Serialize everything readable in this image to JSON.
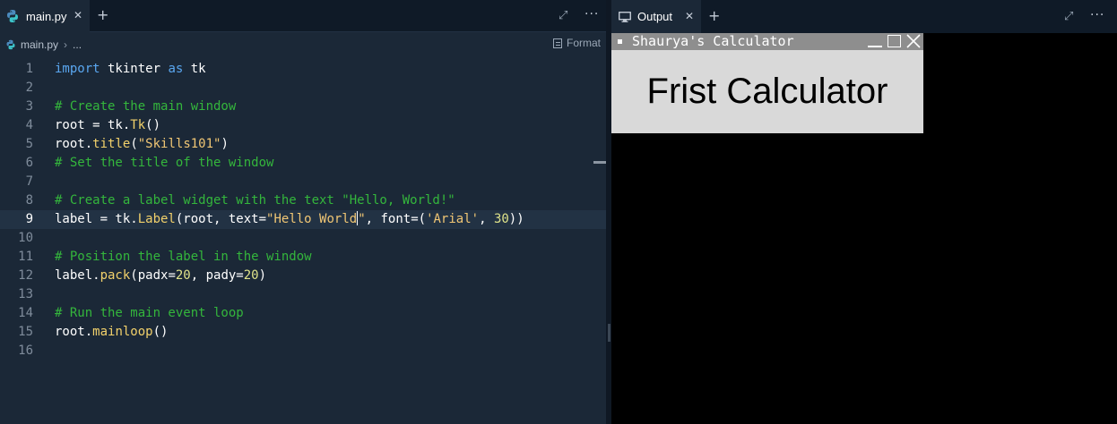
{
  "editor": {
    "tab": {
      "label": "main.py",
      "close": "✕",
      "add": "+"
    },
    "actions": {
      "expand": "⤢",
      "more": "···"
    },
    "breadcrumb": {
      "file": "main.py",
      "sep": "›",
      "rest": "..."
    },
    "format_label": "Format",
    "active_line": 9
  },
  "code": {
    "lines": [
      {
        "n": "1",
        "tokens": [
          [
            "kw",
            "import"
          ],
          [
            "p",
            " tkinter "
          ],
          [
            "kw",
            "as"
          ],
          [
            "p",
            " tk"
          ]
        ]
      },
      {
        "n": "2",
        "tokens": []
      },
      {
        "n": "3",
        "tokens": [
          [
            "cm",
            "# Create the main window"
          ]
        ]
      },
      {
        "n": "4",
        "tokens": [
          [
            "p",
            "root = tk."
          ],
          [
            "fn",
            "Tk"
          ],
          [
            "p",
            "()"
          ]
        ]
      },
      {
        "n": "5",
        "tokens": [
          [
            "p",
            "root."
          ],
          [
            "fn",
            "title"
          ],
          [
            "p",
            "("
          ],
          [
            "str",
            "\"Skills101\""
          ],
          [
            "p",
            ")"
          ]
        ]
      },
      {
        "n": "6",
        "tokens": [
          [
            "cm",
            "# Set the title of the window"
          ]
        ]
      },
      {
        "n": "7",
        "tokens": []
      },
      {
        "n": "8",
        "tokens": [
          [
            "cm",
            "# Create a label widget with the text \"Hello, World!\""
          ]
        ]
      },
      {
        "n": "9",
        "tokens": [
          [
            "p",
            "label = tk."
          ],
          [
            "fn",
            "Label"
          ],
          [
            "p",
            "(root, text="
          ],
          [
            "str",
            "\"Hello World"
          ],
          [
            "caret",
            ""
          ],
          [
            "str",
            "\""
          ],
          [
            "p",
            ", font=("
          ],
          [
            "str",
            "'Arial'"
          ],
          [
            "p",
            ", "
          ],
          [
            "num",
            "30"
          ],
          [
            "p",
            "))"
          ]
        ]
      },
      {
        "n": "10",
        "tokens": []
      },
      {
        "n": "11",
        "tokens": [
          [
            "cm",
            "# Position the label in the window"
          ]
        ]
      },
      {
        "n": "12",
        "tokens": [
          [
            "p",
            "label."
          ],
          [
            "fn",
            "pack"
          ],
          [
            "p",
            "(padx="
          ],
          [
            "num",
            "20"
          ],
          [
            "p",
            ", pady="
          ],
          [
            "num",
            "20"
          ],
          [
            "p",
            ")"
          ]
        ]
      },
      {
        "n": "13",
        "tokens": []
      },
      {
        "n": "14",
        "tokens": [
          [
            "cm",
            "# Run the main event loop"
          ]
        ]
      },
      {
        "n": "15",
        "tokens": [
          [
            "p",
            "root."
          ],
          [
            "fn",
            "mainloop"
          ],
          [
            "p",
            "()"
          ]
        ]
      },
      {
        "n": "16",
        "tokens": []
      }
    ]
  },
  "output": {
    "tab": {
      "label": "Output",
      "close": "✕",
      "add": "+"
    },
    "actions": {
      "expand": "⤢",
      "more": "···"
    },
    "window": {
      "title": "Shaurya's Calculator",
      "label": "Frist Calculator"
    }
  },
  "colors": {
    "editor_bg": "#1b2837",
    "keyword": "#5aa7f0",
    "function": "#f2d16b",
    "string": "#f0c674",
    "comment": "#34b63c",
    "output_bg": "#000000",
    "tk_bg": "#d9d9d9"
  },
  "icons": [
    "python-file-icon",
    "monitor-icon",
    "format-icon",
    "close-icon",
    "expand-icon",
    "more-icon"
  ]
}
